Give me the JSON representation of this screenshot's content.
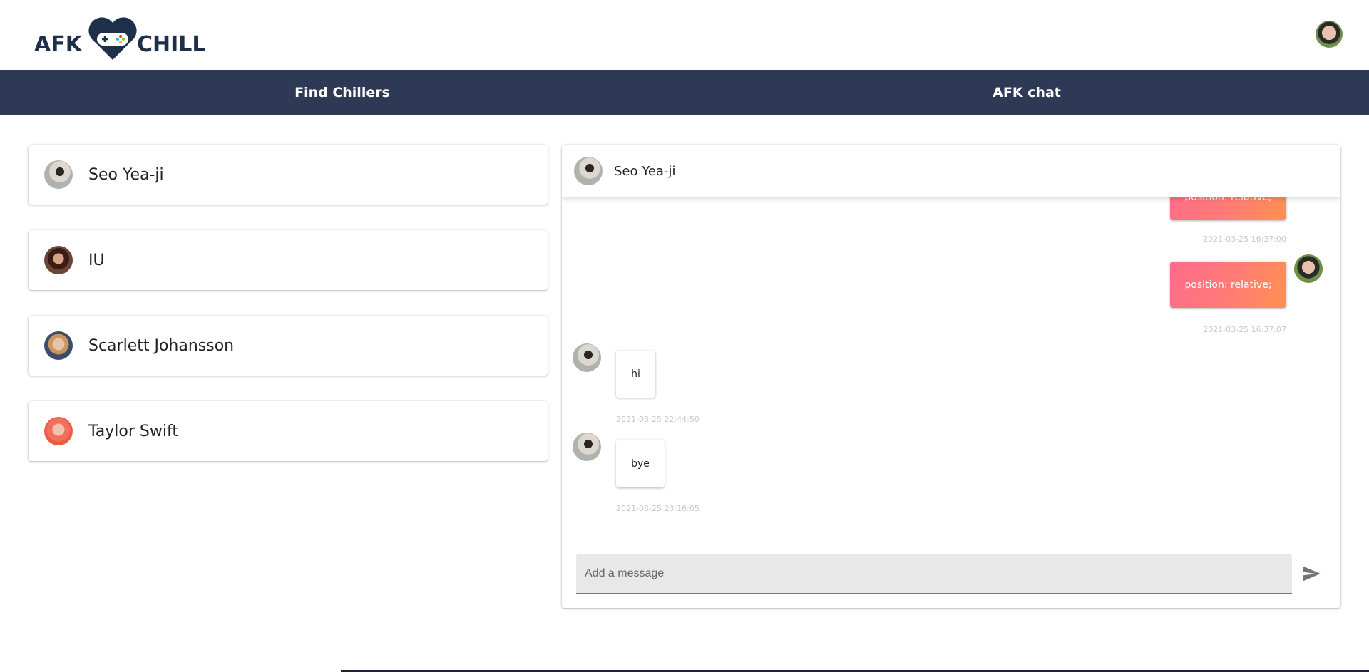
{
  "brand": {
    "logo_text_left": "AFK",
    "logo_text_right": "CHILL"
  },
  "nav": {
    "tabs": [
      {
        "label": "Find Chillers"
      },
      {
        "label": "AFK chat"
      }
    ]
  },
  "chillers": [
    {
      "name": "Seo Yea-ji"
    },
    {
      "name": "IU"
    },
    {
      "name": "Scarlett Johansson"
    },
    {
      "name": "Taylor Swift"
    }
  ],
  "chat": {
    "header_name": "Seo Yea-ji",
    "messages": [
      {
        "text": "position: relative;",
        "time": "2021-03-25 16:37:00",
        "from": "me"
      },
      {
        "text": "position: relative;",
        "time": "2021-03-25 16:37:07",
        "from": "me"
      },
      {
        "text": "hi",
        "time": "2021-03-25 22:44:50",
        "from": "Seo Yea-ji"
      },
      {
        "text": "bye",
        "time": "2021-03-25 23:16:05",
        "from": "Seo Yea-ji"
      }
    ],
    "input_placeholder": "Add a message",
    "input_value": ""
  },
  "colors": {
    "nav_bg": "#2e3a55",
    "bubble_gradient_start": "#ff6b8b",
    "bubble_gradient_end": "#ff9150",
    "logo": "#1e2f49"
  }
}
